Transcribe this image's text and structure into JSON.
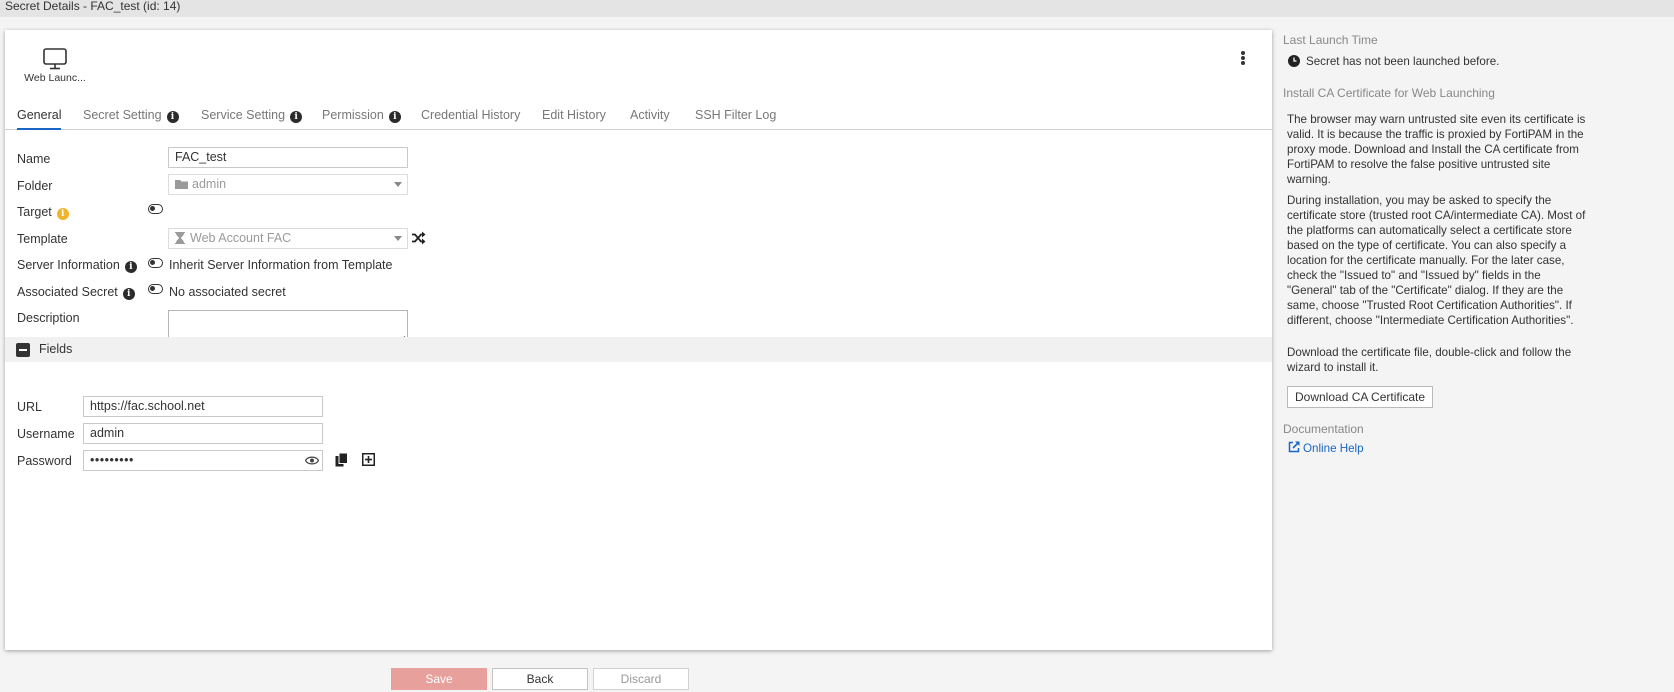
{
  "window": {
    "title": "Secret Details - FAC_test (id: 14)"
  },
  "launcher": {
    "label": "Web Launc...",
    "icon": "monitor-icon"
  },
  "tabs": [
    {
      "label": "General",
      "active": true
    },
    {
      "label": "Secret Setting",
      "info": true
    },
    {
      "label": "Service Setting",
      "info": true
    },
    {
      "label": "Permission",
      "info": true
    },
    {
      "label": "Credential History"
    },
    {
      "label": "Edit History"
    },
    {
      "label": "Activity"
    },
    {
      "label": "SSH Filter Log"
    }
  ],
  "general": {
    "name_label": "Name",
    "name_value": "FAC_test",
    "folder_label": "Folder",
    "folder_value": "admin",
    "target_label": "Target",
    "template_label": "Template",
    "template_value": "Web Account FAC",
    "server_info_label": "Server Information",
    "server_info_text": "Inherit Server Information from Template",
    "assoc_label": "Associated Secret",
    "assoc_text": "No associated secret",
    "description_label": "Description"
  },
  "fields": {
    "title": "Fields",
    "url_label": "URL",
    "url_value": "https://fac.school.net",
    "username_label": "Username",
    "username_value": "admin",
    "password_label": "Password",
    "password_value": "•••••••••"
  },
  "sidebar": {
    "last_launch_heading": "Last Launch Time",
    "last_launch_text": "Secret has not been launched before.",
    "ca_heading": "Install CA Certificate for Web Launching",
    "ca_p1": "The browser may warn untrusted site even its certificate is valid. It is because the traffic is proxied by FortiPAM in the proxy mode. Download and Install the CA certificate from FortiPAM to resolve the false positive untrusted site warning.",
    "ca_p2": "During installation, you may be asked to specify the certificate store (trusted root CA/intermediate CA). Most of the platforms can automatically select a certificate store based on the type of certificate. You can also specify a location for the certificate manually. For the later case, check the \"Issued to\" and \"Issued by\" fields in the \"General\" tab of the \"Certificate\" dialog. If they are the same, choose \"Trusted Root Certification Authorities\". If different, choose \"Intermediate Certification Authorities\".",
    "ca_p3": "Download the certificate file, double-click and follow the wizard to install it.",
    "download_button": "Download CA Certificate",
    "doc_heading": "Documentation",
    "online_help": "Online Help"
  },
  "footer": {
    "save": "Save",
    "back": "Back",
    "discard": "Discard"
  },
  "colors": {
    "accent": "#1a66c2",
    "save_button": "#e7a09b",
    "warning_icon": "#f0b428"
  }
}
